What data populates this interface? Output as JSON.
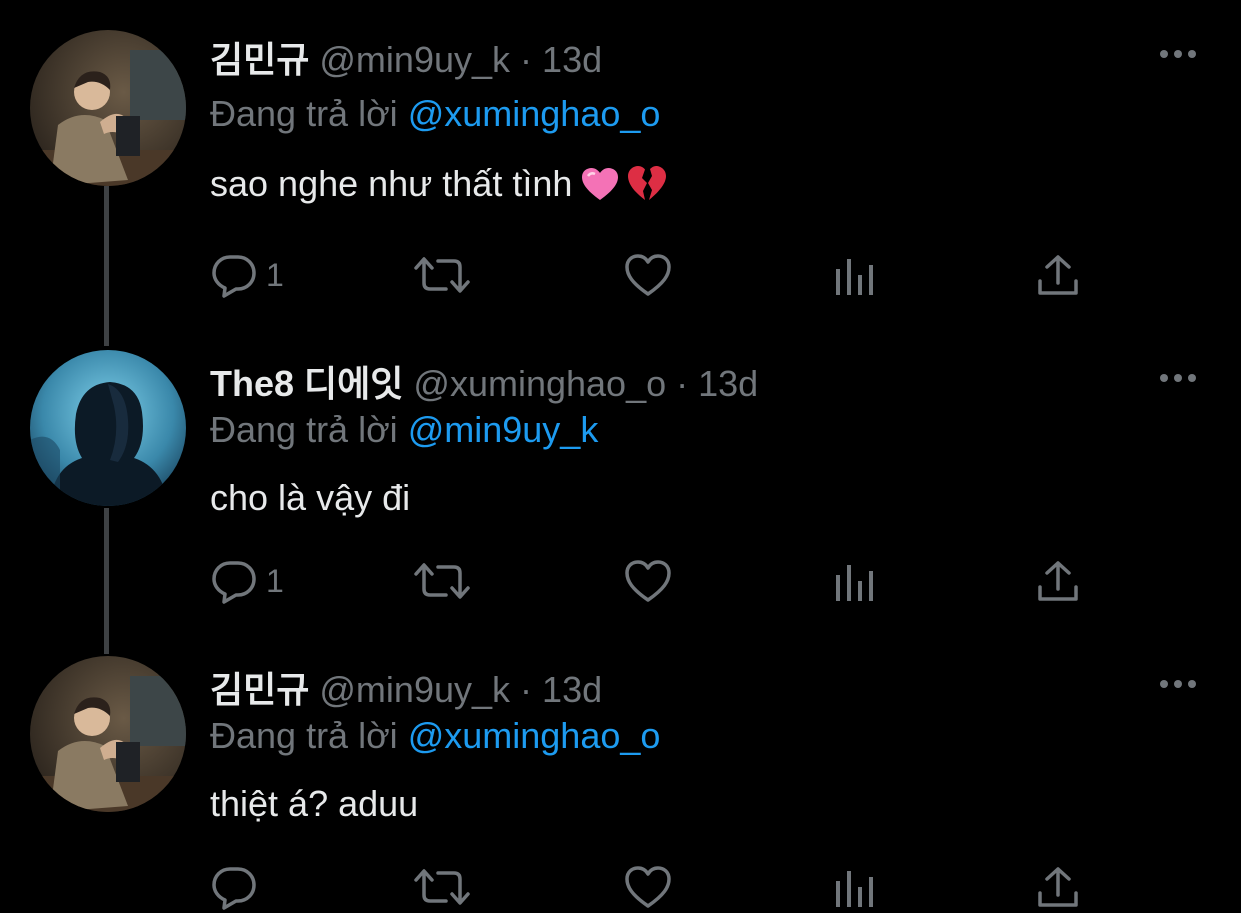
{
  "colors": {
    "background": "#000000",
    "text": "#e7e9ea",
    "muted": "#71767b",
    "mention": "#1d9bf0",
    "thread_line": "#3e4144"
  },
  "reply_prefix": "Đang trả lời",
  "tweets": [
    {
      "display_name": "김민규",
      "handle": "@min9uy_k",
      "separator": "·",
      "time": "13d",
      "reply_to": "@xuminghao_o",
      "text": "sao nghe như thất tình",
      "emojis": [
        "heart-pulse-emoji",
        "broken-heart-emoji"
      ],
      "reply_count": "1",
      "avatar": "user-avatar-mingyu"
    },
    {
      "display_name": "The8 디에잇",
      "handle": "@xuminghao_o",
      "separator": "·",
      "time": "13d",
      "reply_to": "@min9uy_k",
      "text": "cho là vậy đi",
      "emojis": [],
      "reply_count": "1",
      "avatar": "user-avatar-the8"
    },
    {
      "display_name": "김민규",
      "handle": "@min9uy_k",
      "separator": "·",
      "time": "13d",
      "reply_to": "@xuminghao_o",
      "text": "thiệt á? aduu",
      "emojis": [],
      "reply_count": "",
      "avatar": "user-avatar-mingyu"
    }
  ],
  "icons": {
    "reply": "reply-icon",
    "retweet": "retweet-icon",
    "like": "heart-icon",
    "views": "analytics-icon",
    "share": "share-icon",
    "more": "more-icon"
  }
}
